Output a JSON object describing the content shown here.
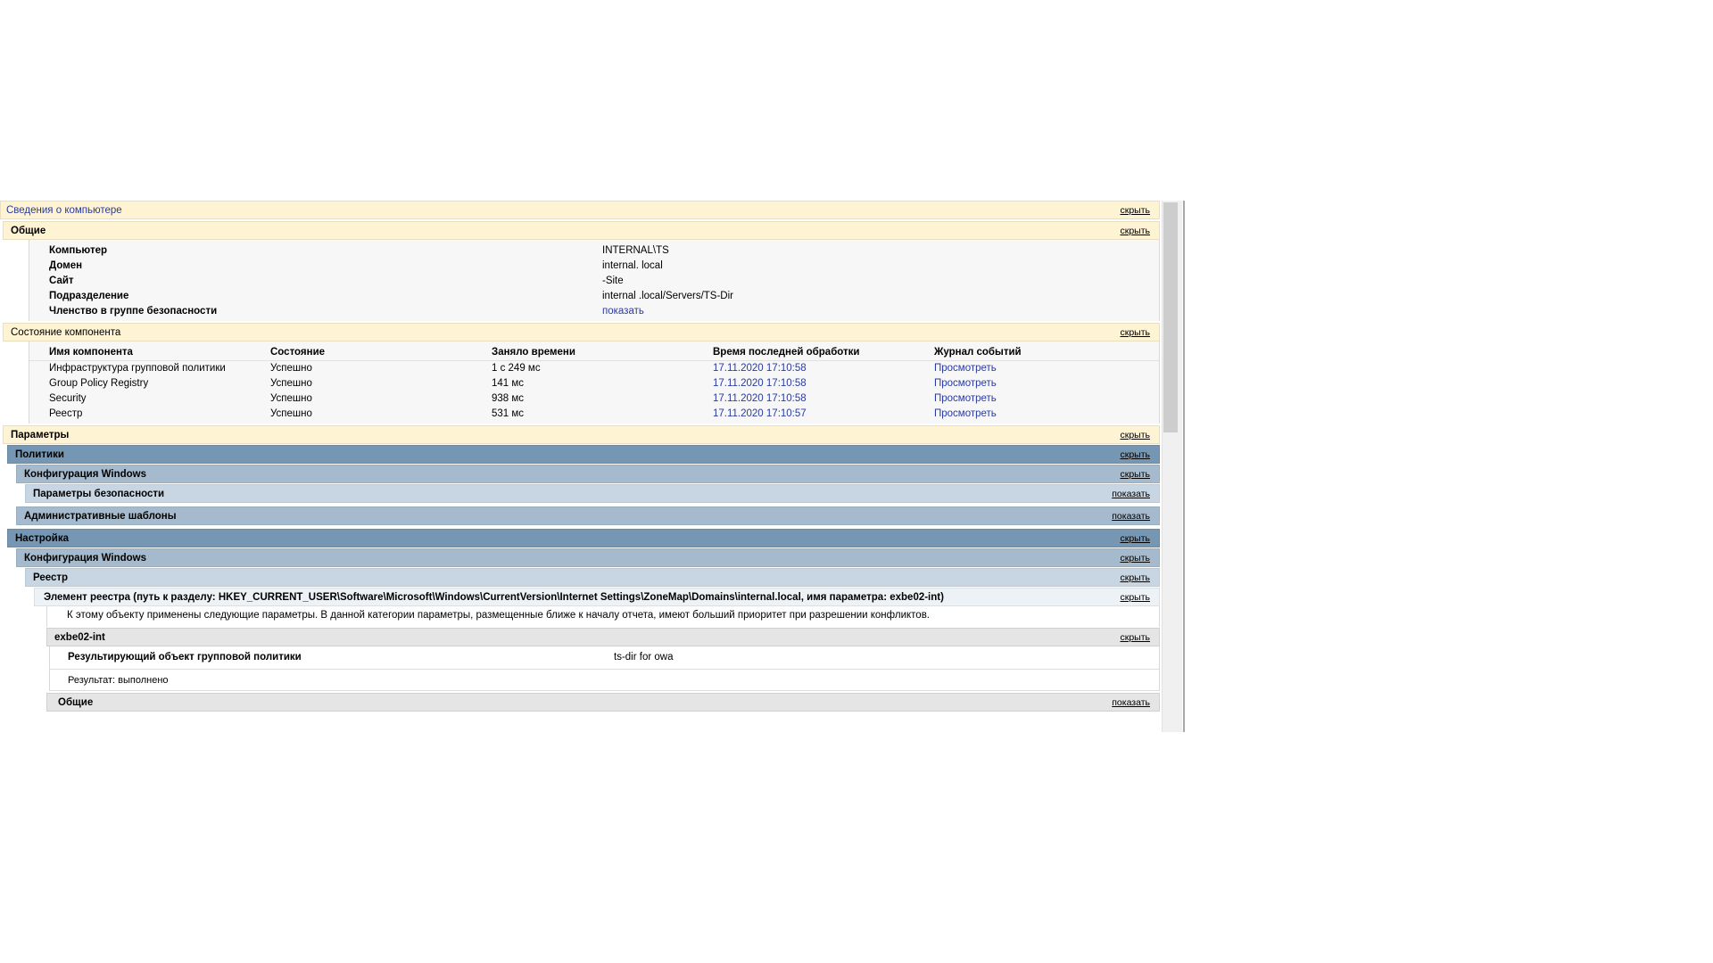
{
  "computer_info": {
    "title": "Сведения о компьютере",
    "toggle": "скрыть"
  },
  "general": {
    "title": "Общие",
    "toggle": "скрыть",
    "rows": [
      {
        "key": "Компьютер",
        "value": "INTERNAL\\TS"
      },
      {
        "key": "Домен",
        "value": "internal.     local"
      },
      {
        "key": "Сайт",
        "value": "            -Site"
      },
      {
        "key": "Подразделение",
        "value": "internal        .local/Servers/TS-Dir"
      },
      {
        "key": "Членство в группе безопасности",
        "value": "показать"
      }
    ]
  },
  "component_status": {
    "title": "Состояние компонента",
    "toggle": "скрыть",
    "columns": [
      "Имя компонента",
      "Состояние",
      "Заняло времени",
      "Время последней обработки",
      "Журнал событий"
    ],
    "rows": [
      [
        "Инфраструктура групповой политики",
        "Успешно",
        "1 с 249 мс",
        "17.11.2020 17:10:58",
        "Просмотреть"
      ],
      [
        "Group Policy Registry",
        "Успешно",
        "141 мс",
        "17.11.2020 17:10:58",
        "Просмотреть"
      ],
      [
        "Security",
        "Успешно",
        "938 мс",
        "17.11.2020 17:10:58",
        "Просмотреть"
      ],
      [
        "Реестр",
        "Успешно",
        "531 мс",
        "17.11.2020 17:10:57",
        "Просмотреть"
      ]
    ]
  },
  "settings": {
    "title": "Параметры",
    "toggle": "скрыть"
  },
  "policies": {
    "title": "Политики",
    "toggle": "скрыть",
    "windows_config": {
      "title": "Конфигурация Windows",
      "toggle": "скрыть"
    },
    "security_settings": {
      "title": "Параметры безопасности",
      "toggle": "показать"
    },
    "admin_templates": {
      "title": "Административные шаблоны",
      "toggle": "показать"
    }
  },
  "preferences": {
    "title": "Настройка",
    "toggle": "скрыть",
    "windows_config": {
      "title": "Конфигурация Windows",
      "toggle": "скрыть"
    },
    "registry": {
      "title": "Реестр",
      "toggle": "скрыть"
    },
    "registry_item": {
      "title": "Элемент реестра (путь к разделу: HKEY_CURRENT_USER\\Software\\Microsoft\\Windows\\CurrentVersion\\Internet Settings\\ZoneMap\\Domains\\internal.local, имя параметра: exbe02-int)",
      "toggle": "скрыть",
      "note": "К этому объекту применены следующие параметры. В данной категории параметры, размещенные ближе к началу отчета, имеют больший приоритет при разрешении конфликтов."
    },
    "exbe": {
      "title": "exbe02-int",
      "toggle": "скрыть",
      "gpo_label": "Результирующий объект групповой политики",
      "gpo_value": "ts-dir for owa",
      "result": "Результат: выполнено",
      "general_title": "Общие",
      "general_toggle": "показать"
    }
  }
}
